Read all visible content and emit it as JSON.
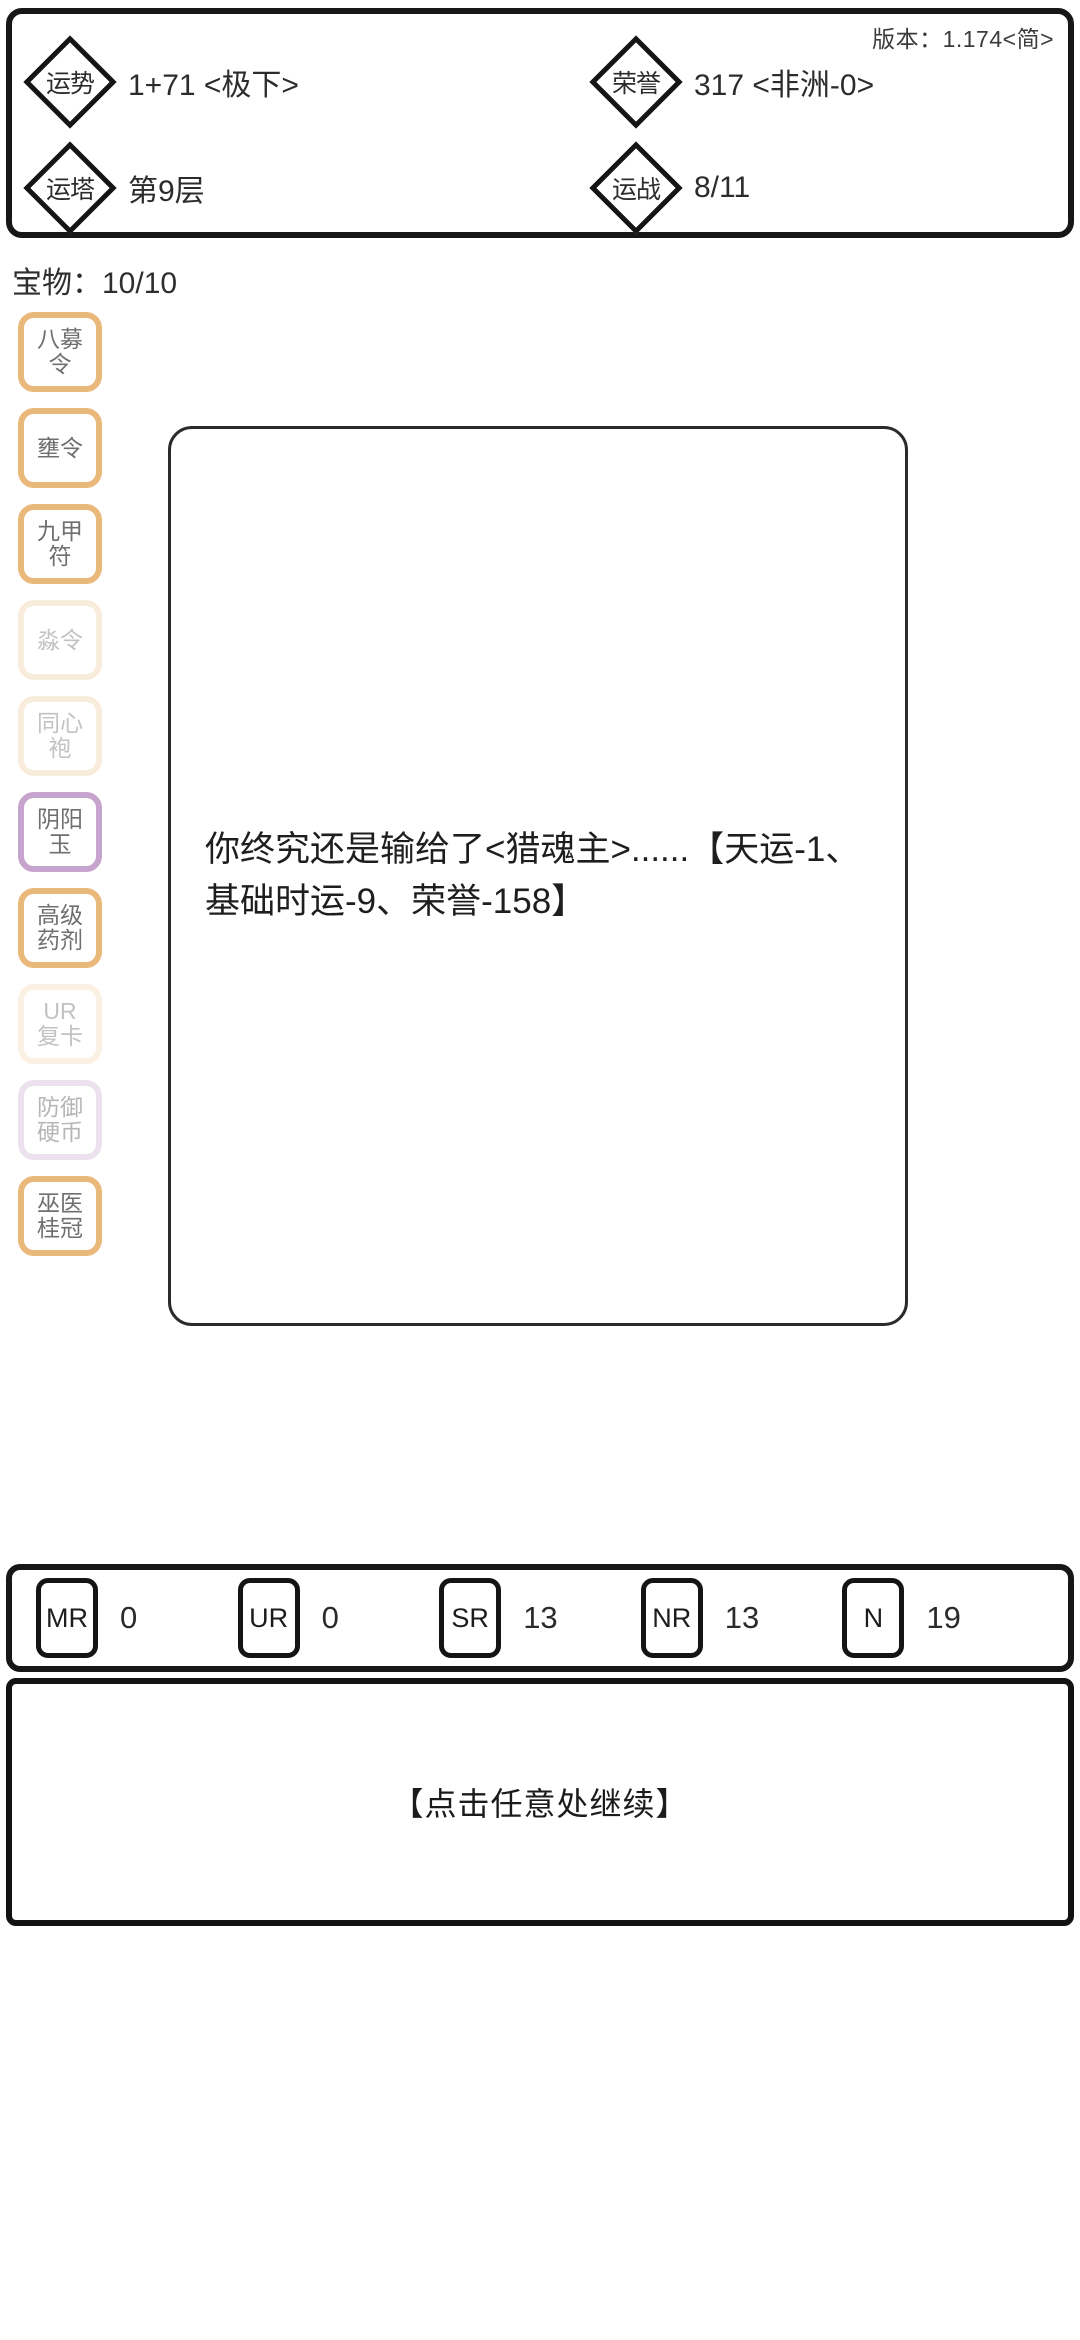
{
  "header": {
    "version_label": "版本：1.174<简>",
    "stats": [
      {
        "icon": "diamond-icon",
        "label": "运势",
        "value": "1+71 <极下>",
        "name": "fortune"
      },
      {
        "icon": "diamond-icon",
        "label": "荣誉",
        "value": "317 <非洲-0>",
        "name": "honor"
      },
      {
        "icon": "diamond-icon",
        "label": "运塔",
        "value": "第9层",
        "name": "fortune-tower"
      },
      {
        "icon": "diamond-icon",
        "label": "运战",
        "value": "8/11",
        "name": "fortune-battle"
      }
    ]
  },
  "treasure": {
    "line": "宝物：10/10",
    "label": "宝物",
    "count": 10,
    "max": 10
  },
  "sidebar": {
    "items": [
      {
        "name": "relic-bamu-ling",
        "line1": "八募",
        "line2": "令",
        "border_color": "#e9b97c",
        "state": "active"
      },
      {
        "name": "relic-yong-ling",
        "line1": "壅令",
        "line2": "",
        "border_color": "#e9b97c",
        "state": "active"
      },
      {
        "name": "relic-jiujia-fu",
        "line1": "九甲",
        "line2": "符",
        "border_color": "#e9b97c",
        "state": "active"
      },
      {
        "name": "relic-miao-ling",
        "line1": "淼令",
        "line2": "",
        "border_color": "#f0d2ab",
        "state": "faded"
      },
      {
        "name": "relic-tongxin-pao",
        "line1": "同心",
        "line2": "袍",
        "border_color": "#f0d2ab",
        "state": "faded"
      },
      {
        "name": "relic-yinyang-yu",
        "line1": "阴阳",
        "line2": "玉",
        "border_color": "#c6a4cd",
        "state": "active"
      },
      {
        "name": "relic-gaoji-yaoji",
        "line1": "高级",
        "line2": "药剂",
        "border_color": "#e9b97c",
        "state": "active"
      },
      {
        "name": "relic-ur-fuka",
        "line1": "UR",
        "line2": "复卡",
        "border_color": "#f4dcbd",
        "state": "faded"
      },
      {
        "name": "relic-fangyu-yingbi",
        "line1": "防御",
        "line2": "硬币",
        "border_color": "#dcc4e0",
        "state": "faded"
      },
      {
        "name": "relic-wuyi-guiguan",
        "line1": "巫医",
        "line2": "桂冠",
        "border_color": "#e9b97c",
        "state": "active"
      }
    ]
  },
  "story": {
    "text": "你终究还是输给了<猎魂主>......【天运-1、基础时运-9、荣誉-158】"
  },
  "rarity_bar": {
    "cells": [
      {
        "name": "rarity-mr",
        "tier": "MR",
        "count": "0"
      },
      {
        "name": "rarity-ur",
        "tier": "UR",
        "count": "0"
      },
      {
        "name": "rarity-sr",
        "tier": "SR",
        "count": "13"
      },
      {
        "name": "rarity-nr",
        "tier": "NR",
        "count": "13"
      },
      {
        "name": "rarity-n",
        "tier": "N",
        "count": "19"
      }
    ]
  },
  "continue": {
    "text": "【点击任意处继续】"
  },
  "colors": {
    "outline": "#17171a",
    "accent_orange": "#e9b97c",
    "accent_purple": "#c6a4cd",
    "text_primary": "#1e1e1e",
    "text_muted": "#6f6f6f",
    "background": "#ffffff"
  }
}
